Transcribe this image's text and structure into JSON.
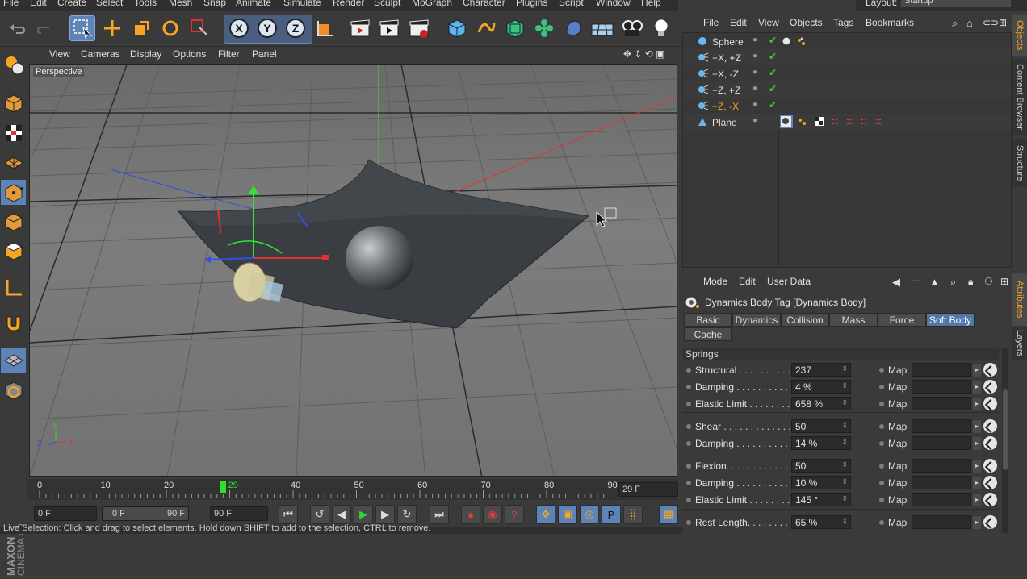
{
  "menubar": {
    "items": [
      "File",
      "Edit",
      "Create",
      "Select",
      "Tools",
      "Mesh",
      "Snap",
      "Animate",
      "Simulate",
      "Render",
      "Sculpt",
      "MoGraph",
      "Character",
      "Plugins",
      "Script",
      "Window",
      "Help"
    ],
    "layout_label": "Layout:",
    "layout_value": "Startup"
  },
  "viewport": {
    "menu": [
      "View",
      "Cameras",
      "Display",
      "Options",
      "Filter",
      "Panel"
    ],
    "label": "Perspective"
  },
  "timeline": {
    "ticks": [
      "0",
      "10",
      "20",
      "29",
      "40",
      "50",
      "60",
      "70",
      "80",
      "90"
    ],
    "current_frame": 29,
    "max_frame": 90,
    "frame_field": "29 F",
    "start_field": "0 F",
    "range_start": "0 F",
    "range_end": "90 F",
    "end_field": "90 F"
  },
  "branding": {
    "maxon": "MAXON",
    "product": "CINEMA 4D"
  },
  "object_manager": {
    "menu": [
      "File",
      "Edit",
      "View",
      "Objects",
      "Tags",
      "Bookmarks"
    ],
    "objects": [
      {
        "name": "Sphere",
        "selected": false,
        "icon": "sphere-icon"
      },
      {
        "name": "+X, +Z",
        "selected": false,
        "icon": "light-icon"
      },
      {
        "name": "+X, -Z",
        "selected": false,
        "icon": "light-icon"
      },
      {
        "name": "+Z, +Z",
        "selected": false,
        "icon": "light-icon"
      },
      {
        "name": "+Z, -X",
        "selected": true,
        "icon": "light-icon"
      },
      {
        "name": "Plane",
        "selected": false,
        "icon": "plane-icon"
      }
    ]
  },
  "side_tabs": {
    "objects": "Objects",
    "content_browser": "Content Browser",
    "structure": "Structure",
    "attributes": "Attributes",
    "layers": "Layers"
  },
  "attributes": {
    "menu": [
      "Mode",
      "Edit",
      "User Data"
    ],
    "title": "Dynamics Body Tag [Dynamics Body]",
    "tabs": [
      "Basic",
      "Dynamics",
      "Collision",
      "Mass",
      "Force",
      "Soft Body",
      "Cache"
    ],
    "active_tab": "Soft Body",
    "section": "Springs",
    "map_label": "Map",
    "params": [
      {
        "label": "Structural . . . . . . . . . .",
        "value": "237"
      },
      {
        "label": "Damping . . . . . . . . . . .",
        "value": "4 %"
      },
      {
        "label": "Elastic Limit . . . . . . . .",
        "value": "658 %"
      },
      {
        "label": "Shear . . . . . . . . . . . . . .",
        "value": "50"
      },
      {
        "label": "Damping . . . . . . . . . . .",
        "value": "14 %"
      },
      {
        "label": "Flexion. . . . . . . . . . . . .",
        "value": "50"
      },
      {
        "label": "Damping . . . . . . . . . . .",
        "value": "10 %"
      },
      {
        "label": "Elastic Limit . . . . . . . .",
        "value": "145 °"
      },
      {
        "label": "Rest Length. . . . . . . . .",
        "value": "65 %"
      }
    ]
  },
  "status": {
    "text": "Live Selection: Click and drag to select elements. Hold down SHIFT to add to the selection, CTRL to remove."
  }
}
